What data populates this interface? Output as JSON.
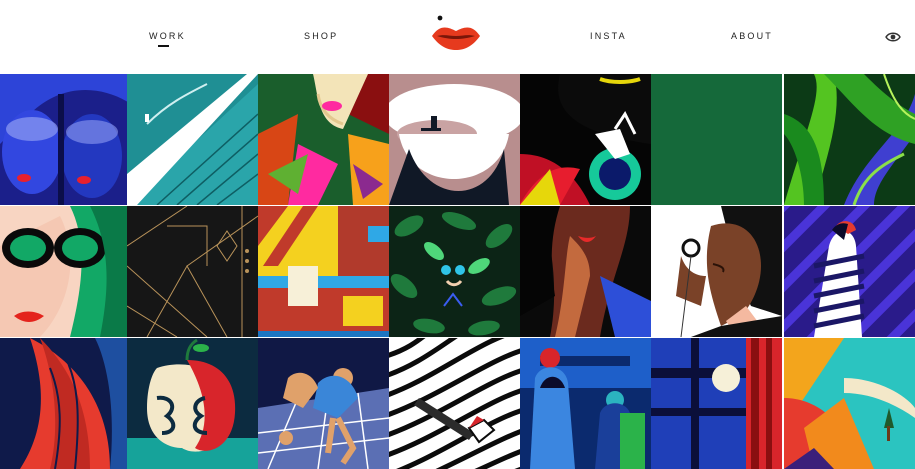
{
  "nav": {
    "items": [
      {
        "label": "WORK",
        "active": true
      },
      {
        "label": "SHOP"
      },
      {
        "label": "INSTA"
      },
      {
        "label": "ABOUT"
      }
    ]
  },
  "logo": {
    "icon": "red-lips-logo-icon",
    "color": "#e63a1e"
  },
  "header_icons": {
    "right": "eye-icon"
  },
  "gallery": {
    "rows": 3,
    "columns": 7,
    "tiles": [
      "astronaut-women-portrait",
      "bridge-teal-illustration",
      "woman-tropical-leaves",
      "teapot-pink",
      "hand-ring-red",
      "green-solid",
      "jungle-leaves",
      "woman-sunglasses-green",
      "art-deco-gold",
      "yellow-room-interior",
      "woman-hidden-in-leaves",
      "woman-red-lips-shadow",
      "woman-holding-lens",
      "woman-striped-purple",
      "woman-red-hair-navy",
      "apple-faces",
      "hopscotch-figures",
      "striped-house",
      "women-blue-balcony",
      "window-moon-blue",
      "road-orange-cliffs"
    ]
  }
}
